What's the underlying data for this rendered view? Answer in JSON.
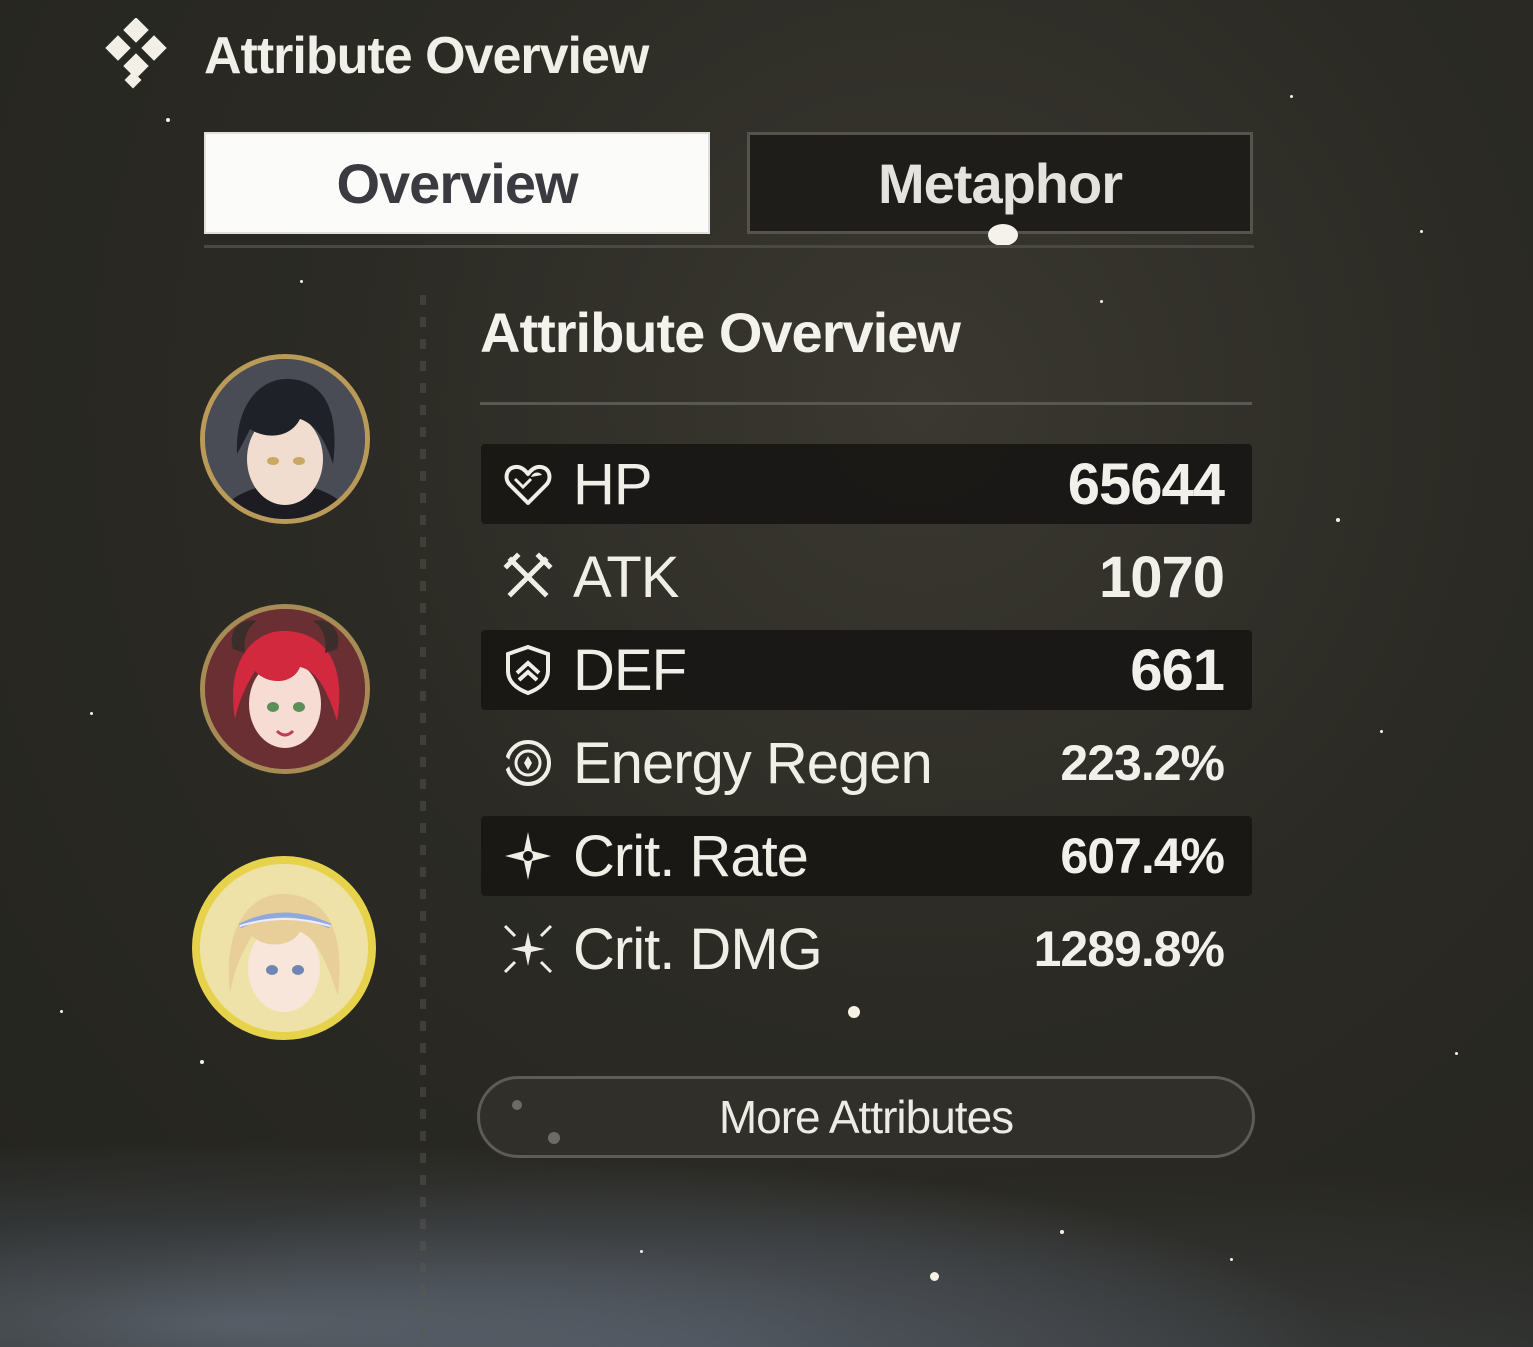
{
  "header": {
    "title": "Attribute Overview",
    "icon": "diamond-cluster-icon"
  },
  "tabs": [
    {
      "label": "Overview",
      "active": true
    },
    {
      "label": "Metaphor",
      "active": false
    }
  ],
  "party": [
    {
      "name": "black-haired-character",
      "ring_color": "#b99a58",
      "selected": false
    },
    {
      "name": "red-haired-horned-character",
      "ring_color": "#a78b55",
      "selected": false
    },
    {
      "name": "blonde-crowned-character",
      "ring_color": "#e7d34b",
      "selected": true
    }
  ],
  "panel": {
    "title": "Attribute Overview",
    "stats": [
      {
        "icon": "heart-icon",
        "label": "HP",
        "value": "65644"
      },
      {
        "icon": "crossed-swords-icon",
        "label": "ATK",
        "value": "1070"
      },
      {
        "icon": "shield-icon",
        "label": "DEF",
        "value": "661"
      },
      {
        "icon": "energy-regen-icon",
        "label": "Energy Regen",
        "value": "223.2%"
      },
      {
        "icon": "star-icon",
        "label": "Crit. Rate",
        "value": "607.4%"
      },
      {
        "icon": "burst-star-icon",
        "label": "Crit. DMG",
        "value": "1289.8%"
      }
    ],
    "more_button": "More Attributes"
  },
  "colors": {
    "accent_gold": "#e7d34b",
    "row_dark": "#181714",
    "text": "#ecebe4"
  }
}
